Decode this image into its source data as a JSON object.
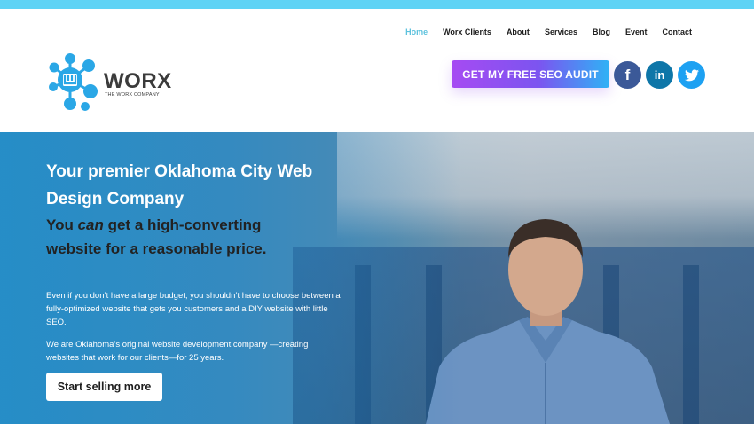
{
  "nav": {
    "items": [
      {
        "label": "Home",
        "active": true
      },
      {
        "label": "Worx Clients"
      },
      {
        "label": "About"
      },
      {
        "label": "Services"
      },
      {
        "label": "Blog"
      },
      {
        "label": "Event"
      },
      {
        "label": "Contact"
      }
    ]
  },
  "logo": {
    "word": "WORX",
    "tagline": "THE WORX COMPANY"
  },
  "cta": {
    "label": "GET MY FREE SEO AUDIT"
  },
  "social": [
    {
      "icon": "facebook-icon",
      "glyph": "f",
      "color": "#3b5998"
    },
    {
      "icon": "linkedin-icon",
      "glyph": "in",
      "color": "#0e76a8"
    },
    {
      "icon": "twitter-icon",
      "color": "#1da1f2"
    }
  ],
  "hero": {
    "title": "Your premier Oklahoma City Web Design Company",
    "sub_1": "You ",
    "sub_em": "can",
    "sub_2": " get a high-converting website for a reasonable price.",
    "para1": "Even if you don’t have a large budget, you shouldn’t have to choose between a fully-optimized website that gets you customers and a DIY website with little SEO.",
    "para2": "We are Oklahoma’s original website development company —creating websites that work for our clients—for 25 years.",
    "button": "Start selling more"
  },
  "colors": {
    "top_strip": "#5fd3f5",
    "active_nav": "#5ec2dd",
    "cta_from": "#a64bf2",
    "cta_to": "#2fb2f5"
  }
}
